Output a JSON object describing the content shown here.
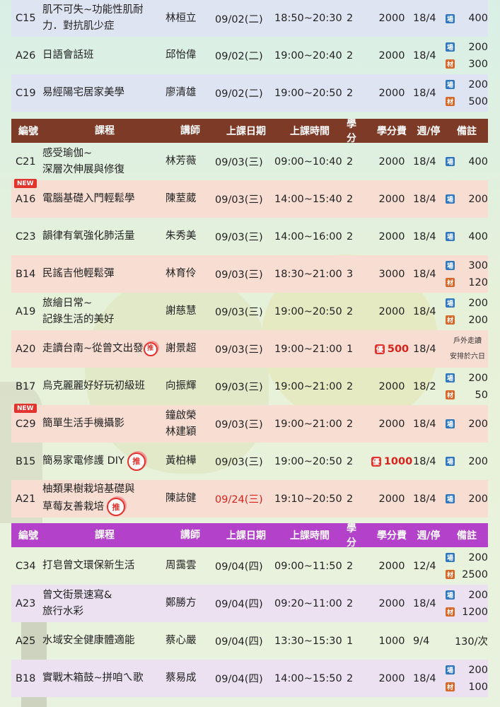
{
  "headers": [
    "編號",
    "課程",
    "講師",
    "上課日期",
    "上課時間",
    "學分",
    "學分費",
    "週/停",
    "備註"
  ],
  "icons": {
    "venue_tag": "場",
    "material_tag": "材",
    "new_badge": "NEW",
    "recommend": "推",
    "discount": "優"
  },
  "colors": {
    "brown_header": "#7d3a26",
    "purple_header": "#b341c9",
    "blue_row": "#dfe4f3",
    "pink_row": "#f7ddd2",
    "purple_row": "#ece1f1",
    "highlight_red": "#d8231d"
  },
  "section1": [
    {
      "code": "C15",
      "course1": "肌不可失~功能性肌耐",
      "course2": "力．對抗肌少症",
      "teacher1": "林桓立",
      "date": "09/02(二)",
      "time": "18:50~20:30",
      "credit": "2",
      "fee": "2000",
      "week": "18/4",
      "v": "400",
      "m": ""
    },
    {
      "code": "A26",
      "course1": "日語會話班",
      "course2": "",
      "teacher1": "邱怡偉",
      "date": "09/02(二)",
      "time": "19:00~20:40",
      "credit": "2",
      "fee": "2000",
      "week": "18/4",
      "v": "200",
      "m": "300"
    },
    {
      "code": "C19",
      "course1": "易經陽宅居家美學",
      "course2": "",
      "teacher1": "廖清雄",
      "date": "09/02(二)",
      "time": "19:00~20:50",
      "credit": "2",
      "fee": "2000",
      "week": "18/4",
      "v": "200",
      "m": "500"
    }
  ],
  "section2": [
    {
      "code": "C21",
      "course1": "感受瑜伽~",
      "course2": "深層次伸展與修復",
      "teacher1": "林芳薇",
      "date": "09/03(三)",
      "time": "09:00~10:40",
      "credit": "2",
      "fee": "2000",
      "week": "18/4",
      "v": "400"
    },
    {
      "code": "A16",
      "course1": "電腦基礎入門輕鬆學",
      "teacher1": "陳荎葳",
      "date": "09/03(三)",
      "time": "14:00~15:40",
      "credit": "2",
      "fee": "2000",
      "week": "18/4",
      "v": "200"
    },
    {
      "code": "C23",
      "course1": "韻律有氧強化肺活量",
      "teacher1": "朱秀美",
      "date": "09/03(三)",
      "time": "14:00~16:00",
      "credit": "2",
      "fee": "2000",
      "week": "18/4",
      "v": "400"
    },
    {
      "code": "B14",
      "course1": "民謠吉他輕鬆彈",
      "teacher1": "林育伶",
      "date": "09/03(三)",
      "time": "18:30~21:00",
      "credit": "3",
      "fee": "3000",
      "week": "18/4",
      "v": "300",
      "m": "120"
    },
    {
      "code": "A19",
      "course1": "旅繪日常~",
      "course2": "記錄生活的美好",
      "teacher1": "謝慈慧",
      "date": "09/03(三)",
      "time": "19:00~20:50",
      "credit": "2",
      "fee": "2000",
      "week": "18/4",
      "v": "200",
      "m": "200"
    },
    {
      "code": "A20",
      "course1": "走讀台南~從曾文出發",
      "teacher1": "謝景超",
      "date": "09/03(三)",
      "time": "19:00~21:00",
      "credit": "1",
      "fee": "500",
      "week": "18/4",
      "note1": "戶外走讀",
      "note2": "安排於六日"
    },
    {
      "code": "B17",
      "course1": "烏克麗麗好好玩初級班",
      "teacher1": "向振輝",
      "date": "09/03(三)",
      "time": "19:00~21:00",
      "credit": "2",
      "fee": "2000",
      "week": "18/2",
      "v": "200",
      "m": "50"
    },
    {
      "code": "C29",
      "course1": "簡單生活手機攝影",
      "teacher1": "鐘啟榮",
      "teacher2": "林建穎",
      "date": "09/03(三)",
      "time": "19:00~21:00",
      "credit": "2",
      "fee": "2000",
      "week": "18/4",
      "v": "200"
    },
    {
      "code": "B15",
      "course1": "簡易家電修護 DIY",
      "teacher1": "黃柏樺",
      "date": "09/03(三)",
      "time": "19:00~20:50",
      "credit": "2",
      "fee": "1000",
      "week": "18/4",
      "v": "200"
    },
    {
      "code": "A21",
      "course1": "柚類果樹栽培基礎與",
      "course2": "草莓友善栽培",
      "teacher1": "陳誌健",
      "date": "09/24(三)",
      "time": "19:10~20:50",
      "credit": "2",
      "fee": "2000",
      "week": "18/4",
      "v": "200"
    }
  ],
  "section3": [
    {
      "code": "C34",
      "course1": "打皂曾文環保新生活",
      "teacher1": "周靄雲",
      "date": "09/04(四)",
      "time": "09:00~11:50",
      "credit": "2",
      "fee": "2000",
      "week": "12/4",
      "v": "200",
      "m": "2500"
    },
    {
      "code": "A23",
      "course1": "曾文街景速寫&",
      "course2": "旅行水彩",
      "teacher1": "鄭勝方",
      "date": "09/04(四)",
      "time": "09:20~11:00",
      "credit": "2",
      "fee": "2000",
      "week": "18/4",
      "v": "200",
      "m": "1200"
    },
    {
      "code": "A25",
      "course1": "水域安全健康體適能",
      "teacher1": "蔡心嚴",
      "date": "09/04(四)",
      "time": "13:30~15:30",
      "credit": "1",
      "fee": "1000",
      "week": "9/4",
      "note": "130/次"
    },
    {
      "code": "B18",
      "course1": "實戰木箱鼓~拼咱ㄟ歌",
      "teacher1": "蔡易成",
      "date": "09/04(四)",
      "time": "14:00~15:50",
      "credit": "2",
      "fee": "2000",
      "week": "18/4",
      "v": "200",
      "m": "100"
    }
  ]
}
